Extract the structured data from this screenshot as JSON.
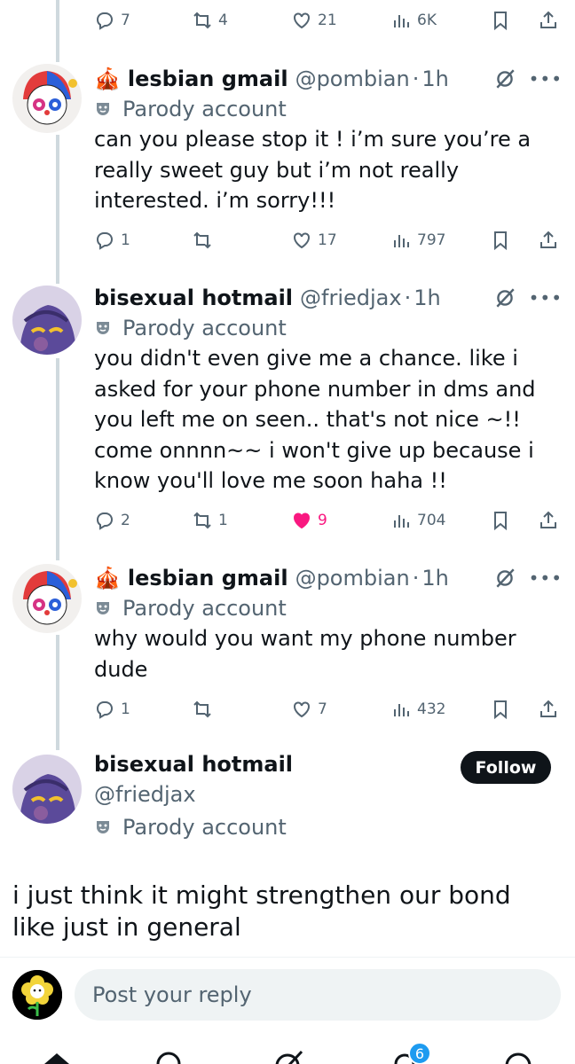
{
  "tweets": [
    {
      "id": "top",
      "replies": "7",
      "retweets": "4",
      "likes": "21",
      "views": "6K"
    },
    {
      "id": "t1",
      "emoji": "🎪",
      "name": "lesbian gmail",
      "handle": "@pombian",
      "time": "1h",
      "parody_label": "Parody account",
      "text": "can you please stop it ! i’m sure you’re a really sweet guy but i’m not really interested. i’m sorry!!!",
      "replies": "1",
      "retweets": "",
      "likes": "17",
      "views": "797"
    },
    {
      "id": "t2",
      "name": "bisexual hotmail",
      "handle": "@friedjax",
      "time": "1h",
      "parody_label": "Parody account",
      "text": "you didn't even give me a chance. like i asked for your phone number in dms and you left me on seen.. that's not nice ~!! come onnnn~~ i won't give up because i know you'll love me soon haha !!",
      "replies": "2",
      "retweets": "1",
      "likes": "9",
      "views": "704"
    },
    {
      "id": "t3",
      "emoji": "🎪",
      "name": "lesbian gmail",
      "handle": "@pombian",
      "time": "1h",
      "parody_label": "Parody account",
      "text": "why would you want my phone number dude",
      "replies": "1",
      "retweets": "",
      "likes": "7",
      "views": "432"
    }
  ],
  "focus": {
    "name": "bisexual hotmail",
    "handle": "@friedjax",
    "parody_label": "Parody account",
    "follow_label": "Follow",
    "text": "i just think it might strengthen our bond like just in general"
  },
  "reply": {
    "placeholder": "Post your reply"
  },
  "tabbar": {
    "notifications_badge": "6",
    "icons": [
      "home-icon",
      "search-icon",
      "grok-icon",
      "notifications-icon",
      "messages-icon"
    ]
  },
  "colors": {
    "text": "#0f1419",
    "muted": "#536471",
    "like_active": "#f91880",
    "thread_line": "#cfd9de",
    "accent": "#1d9bf0"
  }
}
